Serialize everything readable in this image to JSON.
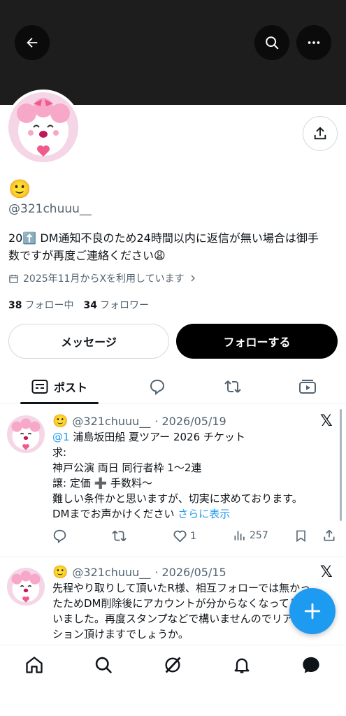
{
  "header": {
    "back_icon": "arrow-left-icon",
    "search_icon": "search-icon",
    "more_icon": "more-horizontal-icon",
    "banner_color": "#1d1d1d"
  },
  "profile": {
    "display_name": "🙂",
    "handle": "@321chuuu__",
    "bio_line1": "20⬆️ DM通知不良のため24時間以内に返信が無い場合は御手",
    "bio_line2": "数ですが再度ご連絡ください😩",
    "joined": "2025年11月からXを利用しています",
    "following_count": "38",
    "following_label": "フォロー中",
    "followers_count": "34",
    "followers_label": "フォロワー",
    "message_label": "メッセージ",
    "follow_label": "フォローする"
  },
  "tabs": {
    "posts_label": "ポスト",
    "replies_icon": "reply-icon",
    "reposts_icon": "repost-icon",
    "media_icon": "media-icon"
  },
  "posts": [
    {
      "name": "🙂",
      "handle": "@321chuuu__",
      "date": "· 2026/05/19",
      "mention": "@1",
      "line1_rest": " 浦島坂田船 夏ツアー 2026 チケット",
      "line2": "求:",
      "line3": "神戸公演 両日 同行者枠 1〜2連",
      "line4": "譲: 定価 ➕ 手数料〜",
      "line5": "難しい条件かと思いますが、切実に求めております。",
      "line6": "DMまでお声かけください",
      "more": "さらに表示",
      "likes": "1",
      "views": "257"
    },
    {
      "name": "🙂",
      "handle": "@321chuuu__",
      "date": "· 2026/05/15",
      "line1": "先程やり取りして頂いたR様、相互フォローでは無かっ",
      "line2": "たためDM削除後にアカウントが分からなくなってしま",
      "line3": "いました。再度スタンプなどで構いませんのでリアク",
      "line4": "ション頂けますでしょうか。"
    }
  ],
  "accent_color": "#1d9bf0"
}
